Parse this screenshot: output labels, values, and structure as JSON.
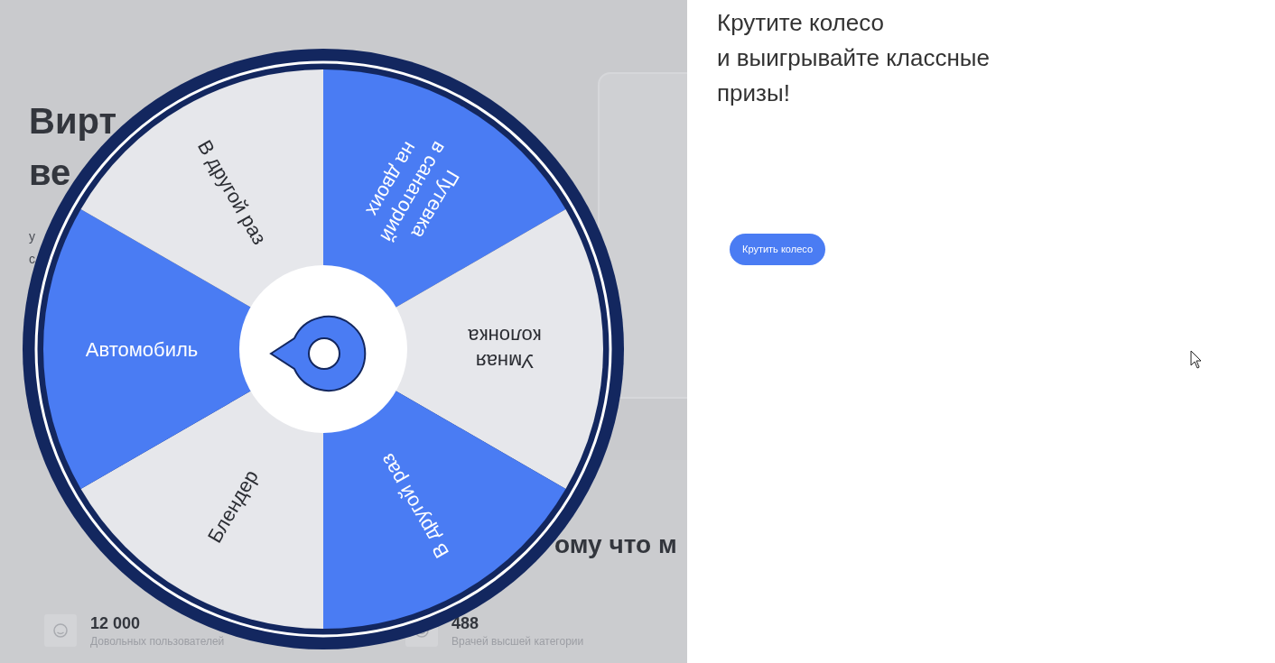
{
  "background_page": {
    "heading_lines": [
      "Вирт",
      "ве"
    ],
    "subtext_lines": [
      "у",
      "с"
    ],
    "section_heading": "ому что м",
    "stats": [
      {
        "value": "12 000",
        "caption": "Довольных пользователей"
      },
      {
        "value": "488",
        "caption": "Врачей высшей категории"
      }
    ]
  },
  "wheel": {
    "segments": [
      {
        "lines": [
          "Путевка",
          "в санаторий",
          "на двоих"
        ],
        "color": "#4a7cf3"
      },
      {
        "lines": [
          "Умная",
          "колонка"
        ],
        "color": "#e6e7eb"
      },
      {
        "lines": [
          "В другой раз"
        ],
        "color": "#4a7cf3"
      },
      {
        "lines": [
          "Блендер"
        ],
        "color": "#e6e7eb"
      },
      {
        "lines": [
          "Автомобиль"
        ],
        "color": "#4a7cf3"
      },
      {
        "lines": [
          "В другой раз"
        ],
        "color": "#e6e7eb"
      }
    ]
  },
  "panel": {
    "title_lines": [
      "Крутите колесо",
      "и выигрывайте классные",
      "призы!"
    ],
    "spin_button": "Крутить колесо"
  }
}
